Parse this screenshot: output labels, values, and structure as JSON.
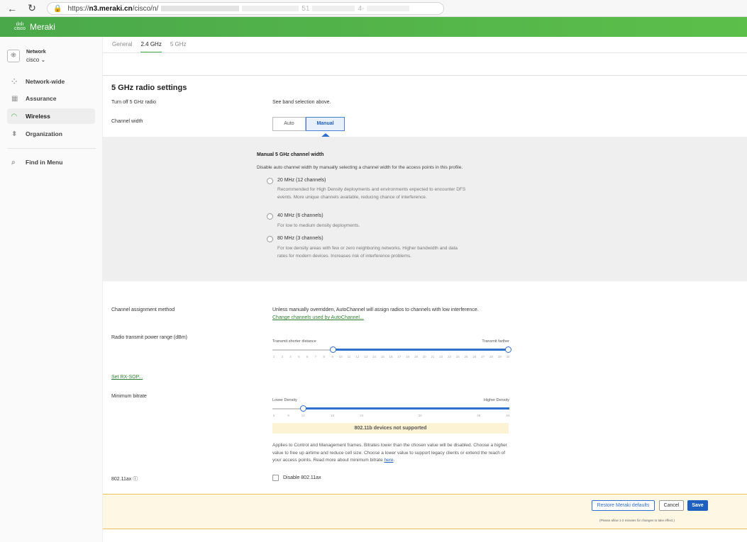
{
  "browser": {
    "url_prefix": "https://",
    "url_host": "n3.meraki.cn",
    "url_path": "/cisco/n/",
    "url_visible_tail_1": "51",
    "url_visible_tail_2": "4-"
  },
  "header": {
    "brand": "Meraki",
    "logo_text": "cisco"
  },
  "sidebar": {
    "network_label": "Network",
    "network_name": "cisco ⌄",
    "items": [
      {
        "label": "Network-wide",
        "icon": "network-wide-icon"
      },
      {
        "label": "Assurance",
        "icon": "assurance-icon"
      },
      {
        "label": "Wireless",
        "icon": "wifi-icon"
      },
      {
        "label": "Organization",
        "icon": "organization-icon"
      },
      {
        "label": "Find in Menu",
        "icon": "search-icon"
      }
    ]
  },
  "tabs": [
    {
      "label": "General"
    },
    {
      "label": "2.4 GHz"
    },
    {
      "label": "5 GHz"
    }
  ],
  "section": {
    "title": "5 GHz radio settings",
    "turn_off_label": "Turn off 5 GHz radio",
    "turn_off_value": "See band selection above.",
    "channel_width_label": "Channel width",
    "channel_width_options": [
      "Auto",
      "Manual"
    ]
  },
  "manual_panel": {
    "title": "Manual 5 GHz channel width",
    "desc": "Disable auto channel width by manually selecting a channel width for the access points in this profile.",
    "options": [
      {
        "label": "20 MHz (12 channels)",
        "desc": "Recommended for High Density deployments and environments expected to encounter DFS events. More unique channels available, reducing chance of interference."
      },
      {
        "label": "40 MHz (6 channels)",
        "desc": "For low to medium density deployments."
      },
      {
        "label": "80 MHz (3 channels)",
        "desc": "For low density areas with few or zero neighboring networks. Higher bandwidth and data rates for modern devices. Increases risk of interference problems."
      }
    ]
  },
  "channel_assignment": {
    "label": "Channel assignment method",
    "text": "Unless manually overridden, AutoChannel will assign radios to channels with low interference.",
    "link": "Change channels used by AutoChannel..."
  },
  "power": {
    "label": "Radio transmit power range (dBm)",
    "left_end": "Transmit shorter distance",
    "right_end": "Transmit farther",
    "ticks": [
      "2",
      "3",
      "4",
      "5",
      "6",
      "7",
      "8",
      "9",
      "10",
      "11",
      "12",
      "13",
      "14",
      "15",
      "16",
      "17",
      "18",
      "19",
      "20",
      "21",
      "22",
      "23",
      "24",
      "25",
      "26",
      "27",
      "28",
      "29",
      "30"
    ],
    "range_min": 9,
    "range_max": 30
  },
  "rx_sop_link": "Set RX-SOP...",
  "bitrate": {
    "label": "Minimum bitrate",
    "left_end": "Lower Density",
    "right_end": "Higher Density",
    "ticks": [
      "6",
      "9",
      "12",
      "18",
      "24",
      "36",
      "48",
      "54"
    ],
    "value": 12,
    "warning": "802.11b devices not supported",
    "applies": "Applies to Control and Management frames. Bitrates lower than the chosen value will be disabled. Choose a higher value to free up airtime and reduce cell size. Choose a lower value to support legacy clients or extend the reach of your access points. Read more about minimum bitrate",
    "applies_link": "here",
    "applies_end": "."
  },
  "ax": {
    "label": "802.11ax ⓘ",
    "checkbox_label": "Disable 802.11ax"
  },
  "footer": {
    "restore": "Restore Meraki defaults",
    "cancel": "Cancel",
    "save": "Save",
    "note": "(Please allow 1-2 minutes for changes to take effect.)"
  }
}
